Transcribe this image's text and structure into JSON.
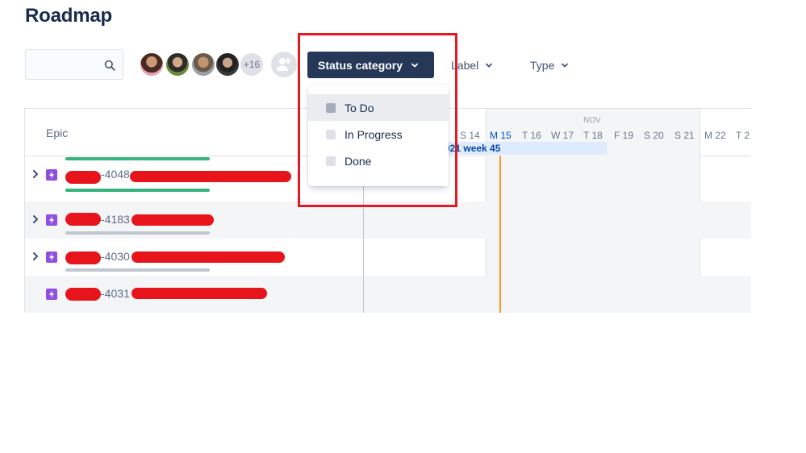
{
  "page": {
    "title": "Roadmap"
  },
  "toolbar": {
    "search": {
      "value": "",
      "placeholder": ""
    },
    "avatars_more": "+16",
    "status_filter": "Status category",
    "label_filter": "Label",
    "type_filter": "Type"
  },
  "status_dropdown": {
    "items": [
      {
        "label": "To Do",
        "checked": false
      },
      {
        "label": "In Progress",
        "checked": false
      },
      {
        "label": "Done",
        "checked": false
      }
    ]
  },
  "roadmap": {
    "epic_header": "Epic",
    "month": "NOV",
    "days": [
      "S 14",
      "M 15",
      "T 16",
      "W 17",
      "T 18",
      "F 19",
      "S 20",
      "S 21",
      "M 22",
      "T 2"
    ],
    "today": "M 15",
    "week_label": "021 week 45",
    "rows": [
      {
        "key": "-4048"
      },
      {
        "key": "-4183"
      },
      {
        "key": "-4030"
      },
      {
        "key": "-4031"
      }
    ]
  },
  "colors": {
    "primary_button": "#253858",
    "today_line": "#ff991f",
    "epic_icon": "#904ee2",
    "progress_done": "#36b37e",
    "annotation": "#e01b24"
  }
}
